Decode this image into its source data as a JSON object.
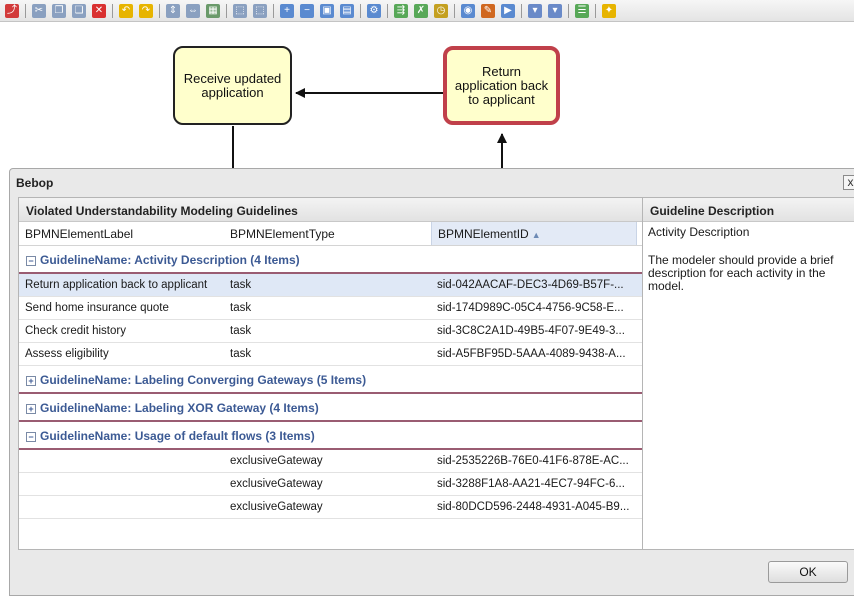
{
  "toolbar": {
    "icons": [
      {
        "name": "pdf-export-icon",
        "color": "#d23b3b",
        "glyph": "⤴"
      },
      {
        "name": "sep"
      },
      {
        "name": "cut-icon",
        "color": "#8aa0c0",
        "glyph": "✂"
      },
      {
        "name": "copy-icon",
        "color": "#8aa0c0",
        "glyph": "❐"
      },
      {
        "name": "paste-icon",
        "color": "#8aa0c0",
        "glyph": "❏"
      },
      {
        "name": "delete-icon",
        "color": "#d93030",
        "glyph": "✕"
      },
      {
        "name": "sep"
      },
      {
        "name": "undo-icon",
        "color": "#e7b400",
        "glyph": "↶"
      },
      {
        "name": "redo-icon",
        "color": "#e7b400",
        "glyph": "↷"
      },
      {
        "name": "sep"
      },
      {
        "name": "align-vertical-icon",
        "color": "#8aa0c0",
        "glyph": "⇕"
      },
      {
        "name": "align-horizontal-icon",
        "color": "#8aa0c0",
        "glyph": "⇔"
      },
      {
        "name": "align-grid-icon",
        "color": "#6a9a6a",
        "glyph": "▦"
      },
      {
        "name": "sep"
      },
      {
        "name": "group-icon",
        "color": "#8aa0c0",
        "glyph": "⬚"
      },
      {
        "name": "ungroup-icon",
        "color": "#8aa0c0",
        "glyph": "⬚"
      },
      {
        "name": "sep"
      },
      {
        "name": "zoom-in-icon",
        "color": "#5a8ad0",
        "glyph": "+"
      },
      {
        "name": "zoom-out-icon",
        "color": "#5a8ad0",
        "glyph": "−"
      },
      {
        "name": "zoom-fit-icon",
        "color": "#5a8ad0",
        "glyph": "▣"
      },
      {
        "name": "zoom-reset-icon",
        "color": "#5a8ad0",
        "glyph": "▤"
      },
      {
        "name": "sep"
      },
      {
        "name": "settings-icon",
        "color": "#5a8ad0",
        "glyph": "⚙"
      },
      {
        "name": "sep"
      },
      {
        "name": "layout-icon",
        "color": "#58a858",
        "glyph": "⇶"
      },
      {
        "name": "shuffle-icon",
        "color": "#58a858",
        "glyph": "✗"
      },
      {
        "name": "clock-icon",
        "color": "#c4a020",
        "glyph": "◷"
      },
      {
        "name": "sep"
      },
      {
        "name": "view-icon",
        "color": "#5a8ad0",
        "glyph": "◉"
      },
      {
        "name": "syntax-check-icon",
        "color": "#d06820",
        "glyph": "✎"
      },
      {
        "name": "play-icon",
        "color": "#5a8ad0",
        "glyph": "▶"
      },
      {
        "name": "sep"
      },
      {
        "name": "new-document-icon",
        "color": "#6a8ac8",
        "glyph": "▾"
      },
      {
        "name": "open-document-icon",
        "color": "#6a8ac8",
        "glyph": "▾"
      },
      {
        "name": "sep"
      },
      {
        "name": "list-icon",
        "color": "#58a858",
        "glyph": "☰"
      },
      {
        "name": "sep"
      },
      {
        "name": "wizard-icon",
        "color": "#e7b400",
        "glyph": "✦"
      }
    ]
  },
  "diagram": {
    "task_receive": "Receive updated application",
    "task_return": "Return application back to applicant"
  },
  "dialog": {
    "title": "Bebop",
    "close_label": "x",
    "ok_label": "OK",
    "left_panel_title": "Violated Understandability Modeling Guidelines",
    "right_panel_title": "Guideline Description",
    "columns": [
      "BPMNElementLabel",
      "BPMNElementType",
      "BPMNElementID"
    ],
    "sort_indicator": "▲",
    "groups": [
      {
        "label": "GuidelineName: Activity Description (4 Items)",
        "expanded": true,
        "rows": [
          {
            "label": "Return application back to applicant",
            "type": "task",
            "id": "sid-042AACAF-DEC3-4D69-B57F-...",
            "selected": true
          },
          {
            "label": "Send home insurance quote",
            "type": "task",
            "id": "sid-174D989C-05C4-4756-9C58-E..."
          },
          {
            "label": "Check credit history",
            "type": "task",
            "id": "sid-3C8C2A1D-49B5-4F07-9E49-3..."
          },
          {
            "label": "Assess eligibility",
            "type": "task",
            "id": "sid-A5FBF95D-5AAA-4089-9438-A..."
          }
        ]
      },
      {
        "label": "GuidelineName: Labeling Converging Gateways (5 Items)",
        "expanded": false,
        "rows": []
      },
      {
        "label": "GuidelineName: Labeling XOR Gateway (4 Items)",
        "expanded": false,
        "rows": []
      },
      {
        "label": "GuidelineName: Usage of default flows (3 Items)",
        "expanded": true,
        "rows": [
          {
            "label": "",
            "type": "exclusiveGateway",
            "id": "sid-2535226B-76E0-41F6-878E-AC..."
          },
          {
            "label": "",
            "type": "exclusiveGateway",
            "id": "sid-3288F1A8-AA21-4EC7-94FC-6..."
          },
          {
            "label": "",
            "type": "exclusiveGateway",
            "id": "sid-80DCD596-2448-4931-A045-B9..."
          }
        ]
      }
    ],
    "description": {
      "name": "Activity Description",
      "text": "The modeler should provide a brief description for each activity in the model."
    }
  }
}
